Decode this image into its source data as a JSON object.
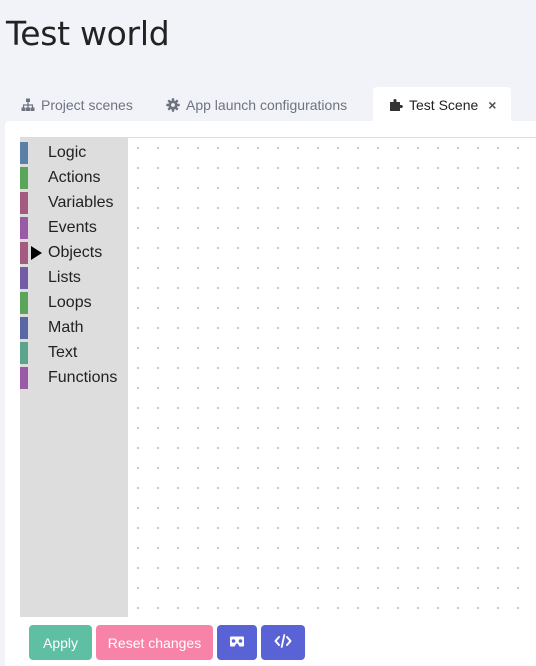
{
  "page": {
    "title": "Test world"
  },
  "tabs": [
    {
      "label": "Project scenes",
      "icon": "sitemap-icon",
      "active": false
    },
    {
      "label": "App launch configurations",
      "icon": "gear-icon",
      "active": false
    },
    {
      "label": "Test Scene",
      "icon": "puzzle-icon",
      "active": true,
      "close_label": "×"
    }
  ],
  "toolbox": {
    "selected": "Objects",
    "categories": [
      {
        "label": "Logic",
        "color": "#5b80a5"
      },
      {
        "label": "Actions",
        "color": "#5ba55b"
      },
      {
        "label": "Variables",
        "color": "#a55b80"
      },
      {
        "label": "Events",
        "color": "#995ba5"
      },
      {
        "label": "Objects",
        "color": "#a55b80"
      },
      {
        "label": "Lists",
        "color": "#745ba5"
      },
      {
        "label": "Loops",
        "color": "#5ba55b"
      },
      {
        "label": "Math",
        "color": "#5b67a5"
      },
      {
        "label": "Text",
        "color": "#5ba58c"
      },
      {
        "label": "Functions",
        "color": "#995ba5"
      }
    ]
  },
  "actions": {
    "apply_label": "Apply",
    "reset_label": "Reset changes",
    "vr_icon": "vr-headset-icon",
    "code_icon": "code-icon"
  },
  "colors": {
    "apply": "#5ebfa3",
    "reset": "#f784a8",
    "primary": "#5963d6",
    "background": "#f2f3f8"
  }
}
